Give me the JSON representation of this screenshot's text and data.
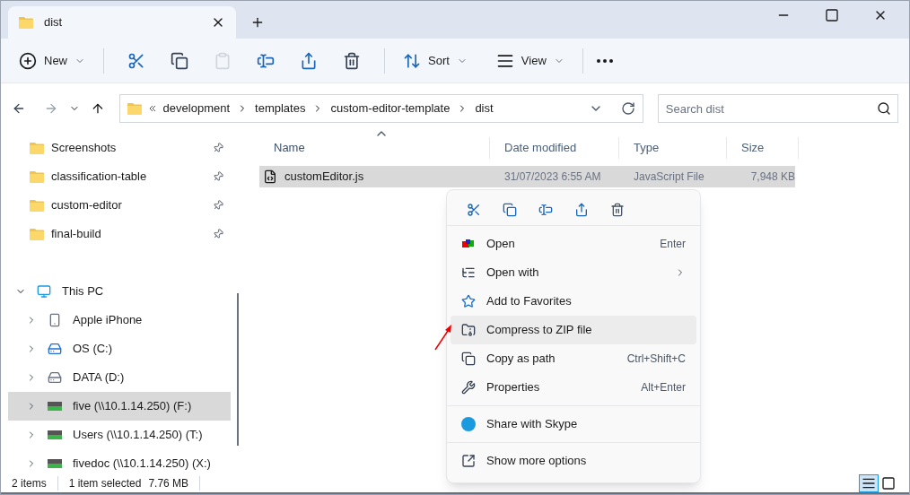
{
  "window": {
    "tab_title": "dist"
  },
  "toolbar": {
    "new_label": "New",
    "sort_label": "Sort",
    "view_label": "View",
    "actions": [
      {
        "kind": "cut",
        "disabled": false
      },
      {
        "kind": "copy",
        "disabled": false
      },
      {
        "kind": "paste",
        "disabled": true
      },
      {
        "kind": "rename",
        "disabled": false
      },
      {
        "kind": "share",
        "disabled": false
      },
      {
        "kind": "delete",
        "disabled": false
      }
    ]
  },
  "nav": {
    "back_disabled": false,
    "forward_disabled": true,
    "breadcrumb": [
      "development",
      "templates",
      "custom-editor-template",
      "dist"
    ],
    "search": {
      "placeholder": "Search dist"
    }
  },
  "sidebar": {
    "quick_access": [
      {
        "label": "Screenshots",
        "pinned": true
      },
      {
        "label": "classification-table",
        "pinned": true
      },
      {
        "label": "custom-editor",
        "pinned": true
      },
      {
        "label": "final-build",
        "pinned": true
      }
    ],
    "this_pc": {
      "label": "This PC",
      "expanded": true,
      "children": [
        {
          "label": "Apple iPhone",
          "kind": "phone",
          "selected": false
        },
        {
          "label": "OS (C:)",
          "kind": "os",
          "selected": false
        },
        {
          "label": "DATA (D:)",
          "kind": "drive",
          "selected": false
        },
        {
          "label": "five (\\\\10.1.14.250) (F:)",
          "kind": "network",
          "selected": true
        },
        {
          "label": "Users (\\\\10.1.14.250) (T:)",
          "kind": "network",
          "selected": false
        },
        {
          "label": "fivedoc (\\\\10.1.14.250) (X:)",
          "kind": "network",
          "selected": false
        }
      ]
    }
  },
  "table": {
    "columns": [
      {
        "label": "Name",
        "sorted": true
      },
      {
        "label": "Date modified",
        "sorted": false
      },
      {
        "label": "Type",
        "sorted": false
      },
      {
        "label": "Size",
        "sorted": false
      }
    ],
    "rows": [
      {
        "name": "customEditor.js",
        "date": "31/07/2023 6:55 AM",
        "type": "JavaScript File",
        "size": "7,948 KB",
        "selected": true
      }
    ]
  },
  "context_menu": {
    "groups": [
      [
        {
          "label": "Open",
          "kind": "open",
          "shortcut": "Enter",
          "submenu": false,
          "highlighted": false
        },
        {
          "label": "Open with",
          "kind": "openwith",
          "submenu": true,
          "highlighted": false
        },
        {
          "label": "Add to Favorites",
          "kind": "star",
          "submenu": false,
          "highlighted": false
        },
        {
          "label": "Compress to ZIP file",
          "kind": "zip",
          "submenu": false,
          "highlighted": true
        },
        {
          "label": "Copy as path",
          "kind": "path",
          "shortcut": "Ctrl+Shift+C",
          "submenu": false,
          "highlighted": false
        },
        {
          "label": "Properties",
          "kind": "wrench",
          "shortcut": "Alt+Enter",
          "submenu": false,
          "highlighted": false
        }
      ],
      [
        {
          "label": "Share with Skype",
          "kind": "skype",
          "submenu": false,
          "highlighted": false
        }
      ],
      [
        {
          "label": "Show more options",
          "kind": "more",
          "submenu": false,
          "highlighted": false
        }
      ]
    ]
  },
  "status_bar": {
    "items": "2 items",
    "selected": "1 item selected",
    "size": "7.76 MB",
    "views": [
      {
        "kind": "details",
        "selected": true
      },
      {
        "kind": "tiles",
        "selected": false
      }
    ]
  }
}
